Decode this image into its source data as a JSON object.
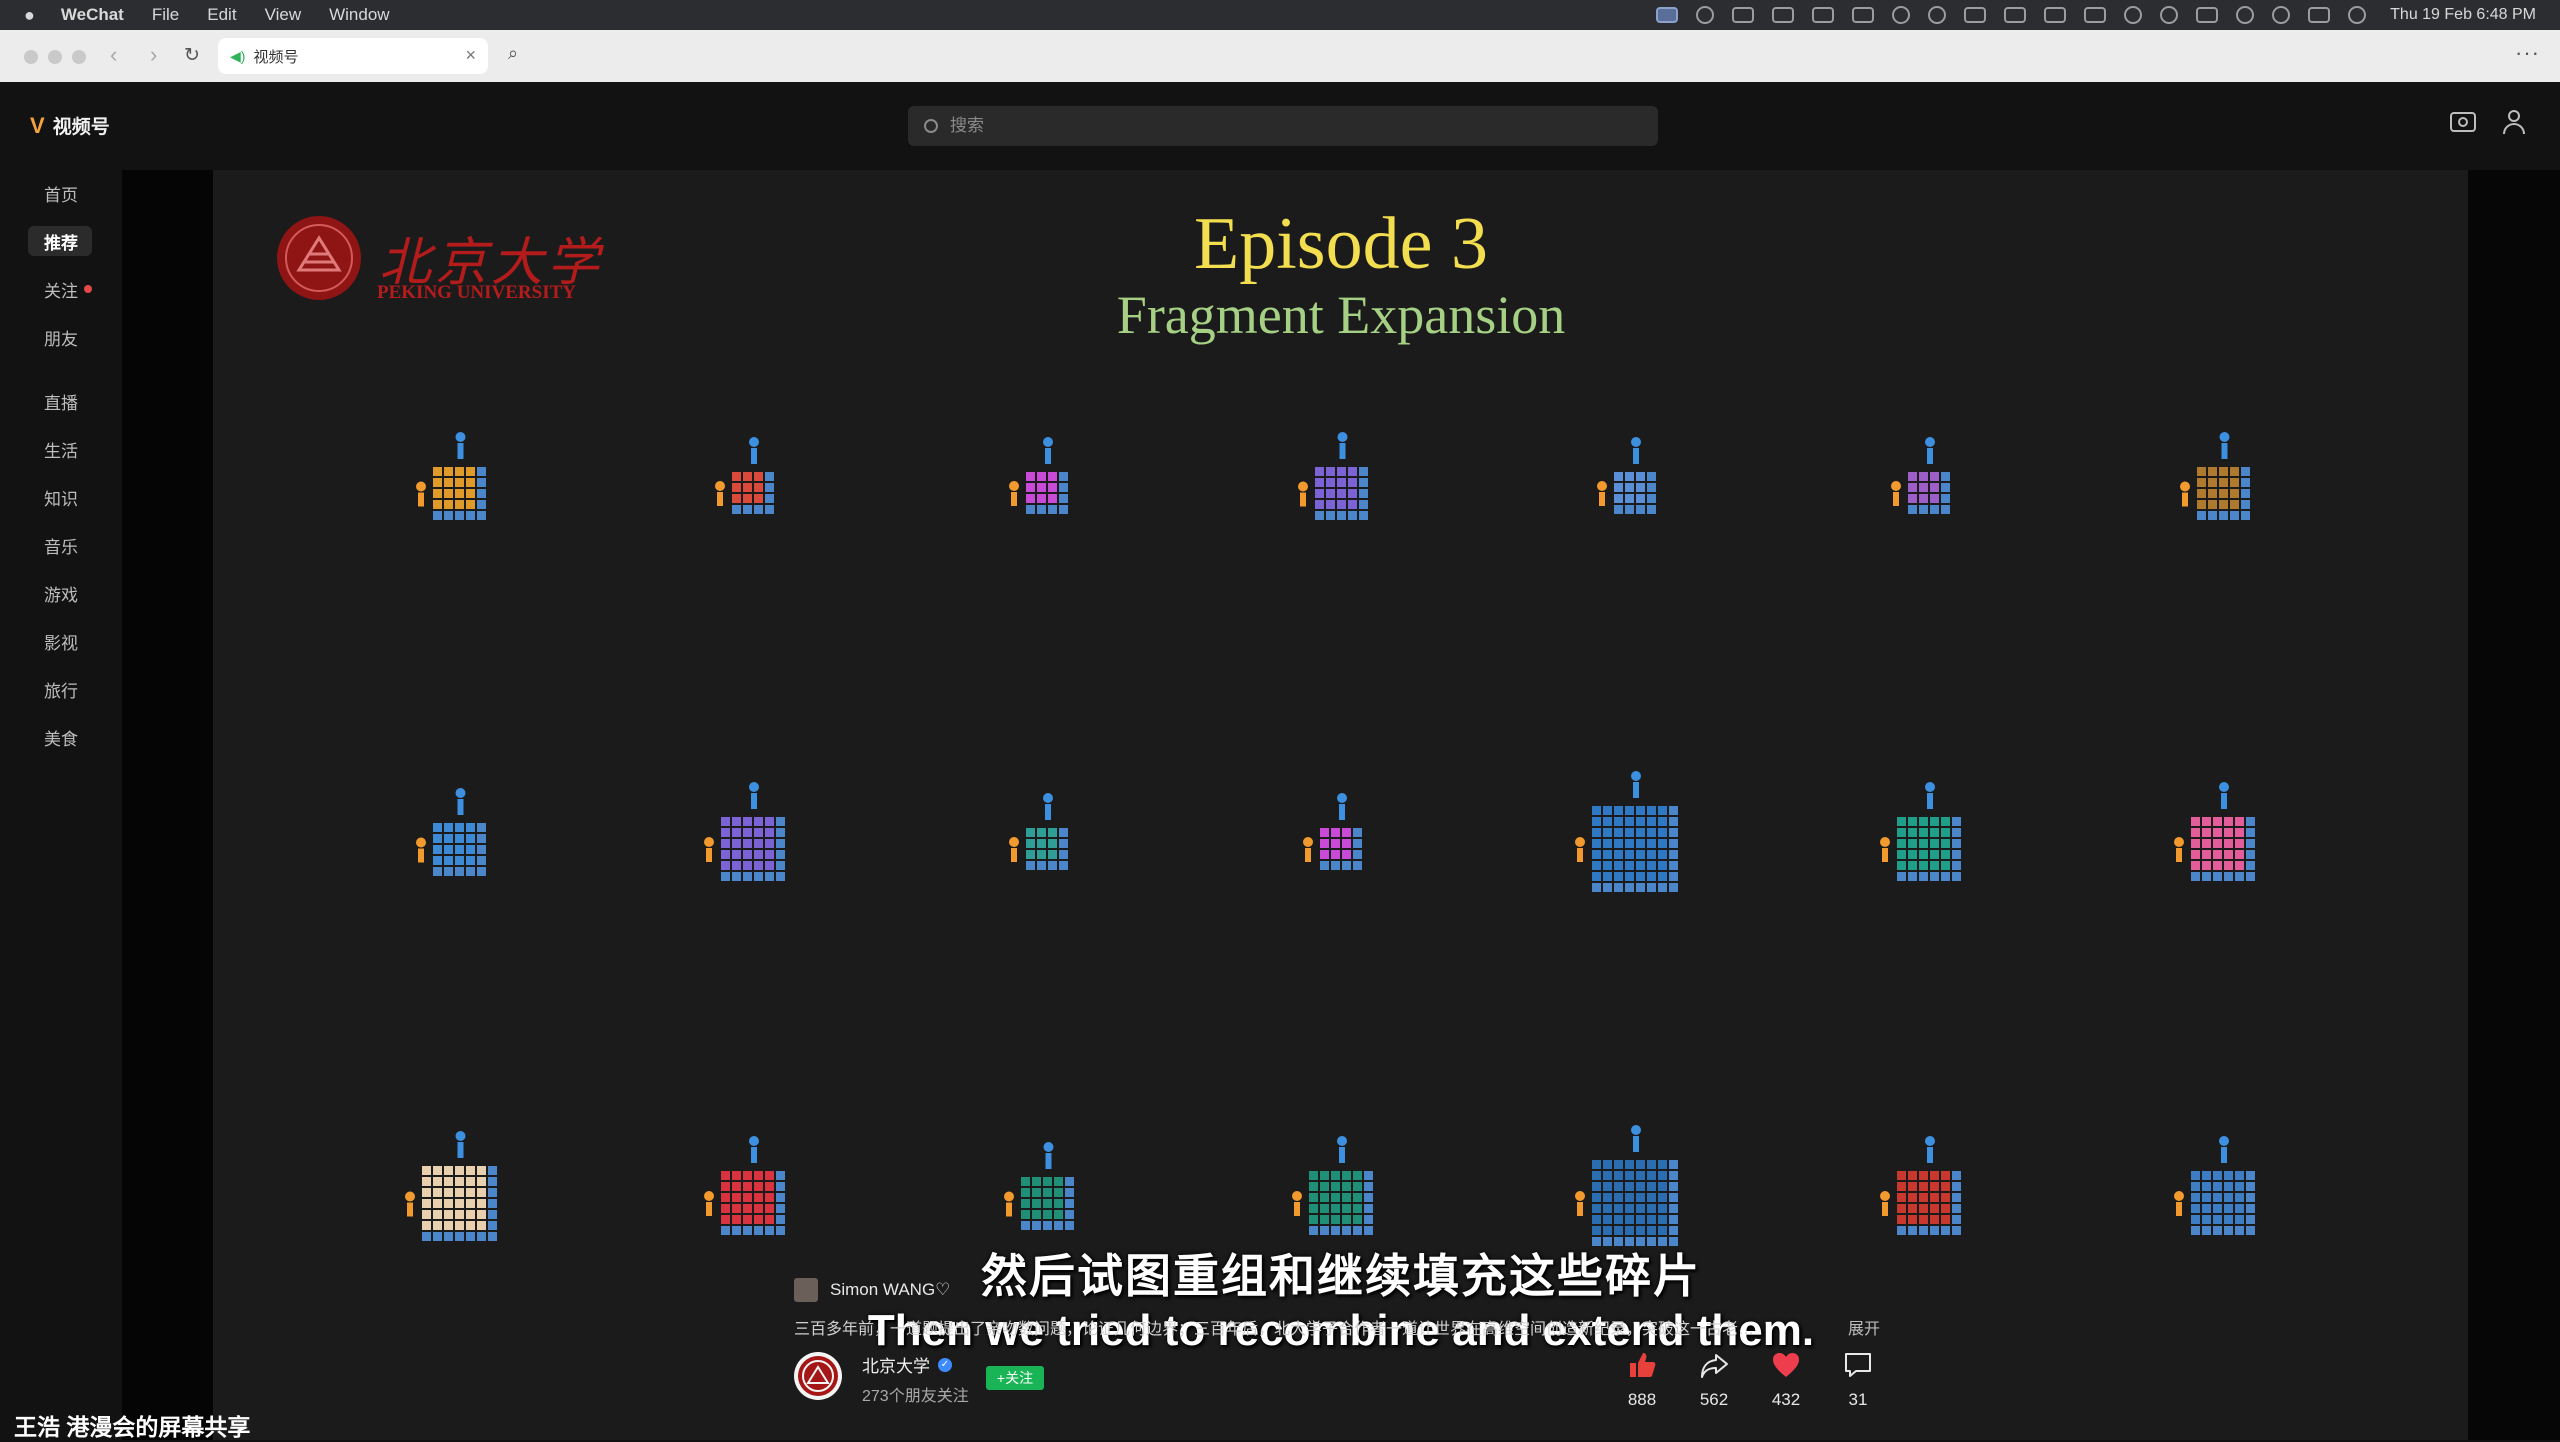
{
  "menubar": {
    "app": "WeChat",
    "menus": [
      "File",
      "Edit",
      "View",
      "Window"
    ],
    "clock": "Thu 19 Feb  6:48 PM"
  },
  "browser": {
    "tab_title": "视频号"
  },
  "header": {
    "brand": "视频号",
    "search_placeholder": "搜索"
  },
  "sidebar": {
    "items": [
      {
        "label": "首页"
      },
      {
        "label": "推荐"
      },
      {
        "label": "关注"
      },
      {
        "label": "朋友"
      },
      {
        "label": "直播"
      },
      {
        "label": "生活"
      },
      {
        "label": "知识"
      },
      {
        "label": "音乐"
      },
      {
        "label": "游戏"
      },
      {
        "label": "影视"
      },
      {
        "label": "旅行"
      },
      {
        "label": "美食"
      }
    ],
    "selected": "推荐",
    "badge_on": "关注"
  },
  "video": {
    "logo_cn": "北京大学",
    "logo_en": "PEKING UNIVERSITY",
    "title": "Episode 3",
    "subtitle": "Fragment Expansion",
    "caption_cn": "然后试图重组和继续填充这些碎片",
    "caption_en": "Then we tried to recombine and extend them.",
    "colors": {
      "title": "#f2de4f",
      "subtitle": "#a6d184",
      "logo": "#b41c1c"
    },
    "figures": [
      {
        "color": "#e09a2a"
      },
      {
        "color": "#d94a3a"
      },
      {
        "color": "#c94ad6"
      },
      {
        "color": "#7b63d6"
      },
      {
        "color": "#5a8ed6"
      },
      {
        "color": "#9b5fc7"
      },
      {
        "color": "#b07a2e"
      },
      {
        "color": "#3c8ad6"
      },
      {
        "color": "#7b63d6"
      },
      {
        "color": "#2f9e97"
      },
      {
        "color": "#c94ad6"
      },
      {
        "color": "#2f78c4"
      },
      {
        "color": "#1f9e8a"
      },
      {
        "color": "#e35d9a"
      },
      {
        "color": "#e8cfae"
      },
      {
        "color": "#d9333f"
      },
      {
        "color": "#1f8f78"
      },
      {
        "color": "#1f8f78"
      },
      {
        "color": "#2a6db0"
      },
      {
        "color": "#c8382e"
      },
      {
        "color": "#3c7dc4"
      }
    ]
  },
  "post": {
    "author": "Simon WANG♡",
    "description": "三百多年前，一道题提出了亲吻数问题，论证几何边界；三百年后，北大学子合作者一道让世界在高维空间创造新纪录，突破这一古老…",
    "expand": "展开",
    "channel": "北京大学",
    "followers": "273个朋友关注",
    "follow": "+关注",
    "likes": "888",
    "shares": "562",
    "hearts": "432",
    "comments": "31"
  },
  "screen_share": "王浩 港漫会的屏幕共享"
}
